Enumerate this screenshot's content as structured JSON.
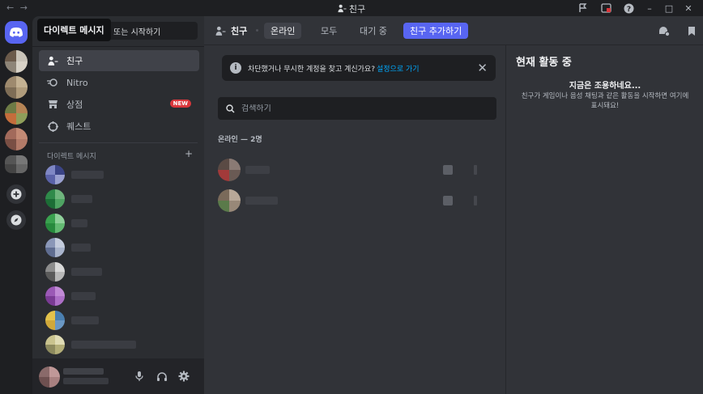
{
  "titlebar": {
    "nav": "← →",
    "title": "친구",
    "window_controls": [
      "–",
      "□",
      "✕"
    ]
  },
  "sidebar": {
    "search": {
      "tooltip": "다이렉트 메시지",
      "rest": "또는 시작하기"
    },
    "nav": [
      {
        "label": "친구",
        "icon": "friends-icon",
        "active": true
      },
      {
        "label": "Nitro",
        "icon": "nitro-icon",
        "active": false
      },
      {
        "label": "상점",
        "icon": "shop-icon",
        "active": false,
        "badge": "NEW"
      },
      {
        "label": "퀘스트",
        "icon": "quest-icon",
        "active": false
      }
    ],
    "dm_header": "다이렉트 메시지",
    "dm_add": "+"
  },
  "colors": {
    "brand": "#5865f2",
    "new_badge": "#da373c",
    "link": "#00a8fc"
  },
  "topbar": {
    "title": "친구",
    "tabs": [
      {
        "label": "온라인",
        "selected": true
      },
      {
        "label": "모두",
        "selected": false
      },
      {
        "label": "대기 중",
        "selected": false
      }
    ],
    "add_friend": "친구 추가하기"
  },
  "notice": {
    "text": "차단했거나 무시한 계정을 찾고 계신가요?",
    "link": "설정으로 가기",
    "close": "✕"
  },
  "friends": {
    "search_placeholder": "검색하기",
    "online_label": "온라인 — 2명"
  },
  "activity": {
    "title": "현재 활동 중",
    "heading": "지금은 조용하네요...",
    "body": "친구가 게임이나 음성 채팅과 같은 활동을 시작하면 여기에 표시돼요!"
  }
}
